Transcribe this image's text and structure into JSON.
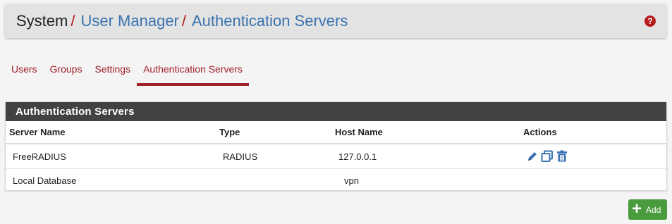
{
  "breadcrumb": {
    "root": "System",
    "separator": "/",
    "items": [
      "User Manager",
      "Authentication Servers"
    ]
  },
  "help": {
    "icon": "question-circle-icon",
    "glyph": "?"
  },
  "tabs": [
    {
      "label": "Users",
      "active": false
    },
    {
      "label": "Groups",
      "active": false
    },
    {
      "label": "Settings",
      "active": false
    },
    {
      "label": "Authentication Servers",
      "active": true
    }
  ],
  "panel": {
    "title": "Authentication Servers",
    "columns": [
      "Server Name",
      "Type",
      "Host Name",
      "Actions"
    ],
    "rows": [
      {
        "name": "FreeRADIUS",
        "type": "RADIUS",
        "host": "127.0.0.1",
        "actions": [
          "edit-icon",
          "copy-icon",
          "delete-icon"
        ]
      },
      {
        "name": "Local Database",
        "type": "",
        "host": "vpn",
        "actions": []
      }
    ]
  },
  "add_button": {
    "label": "Add",
    "icon": "plus-icon"
  },
  "colors": {
    "link": "#3a73b0",
    "accent": "#a1202a",
    "panel_header": "#424242",
    "add_green": "#4a9a3e"
  }
}
